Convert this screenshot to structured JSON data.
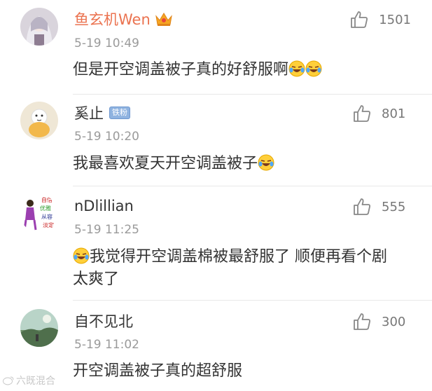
{
  "comments": [
    {
      "username": "鱼玄机Wen",
      "time": "5-19 10:49",
      "text": "但是开空调盖被子真的好舒服啊",
      "likes": "1501",
      "vip": true
    },
    {
      "username": "奚止",
      "badge": "铁粉",
      "time": "5-19 10:20",
      "text": "我最喜欢夏天开空调盖被子",
      "likes": "801"
    },
    {
      "username": "nDlillian",
      "time": "5-19 11:25",
      "text": "我觉得开空调盖棉被最舒服了 顺便再看个剧 太爽了",
      "likes": "555",
      "avatar_text": [
        "自信",
        "优雅",
        "从容",
        "淡定"
      ]
    },
    {
      "username": "自不见北",
      "time": "5-19 11:02",
      "text": "开空调盖被子真的超舒服",
      "likes": "300"
    }
  ],
  "watermark": "六既混合",
  "colors": {
    "vip_name": "#eb7350",
    "time": "#9a9a9a",
    "text": "#333333",
    "like": "#777777"
  }
}
